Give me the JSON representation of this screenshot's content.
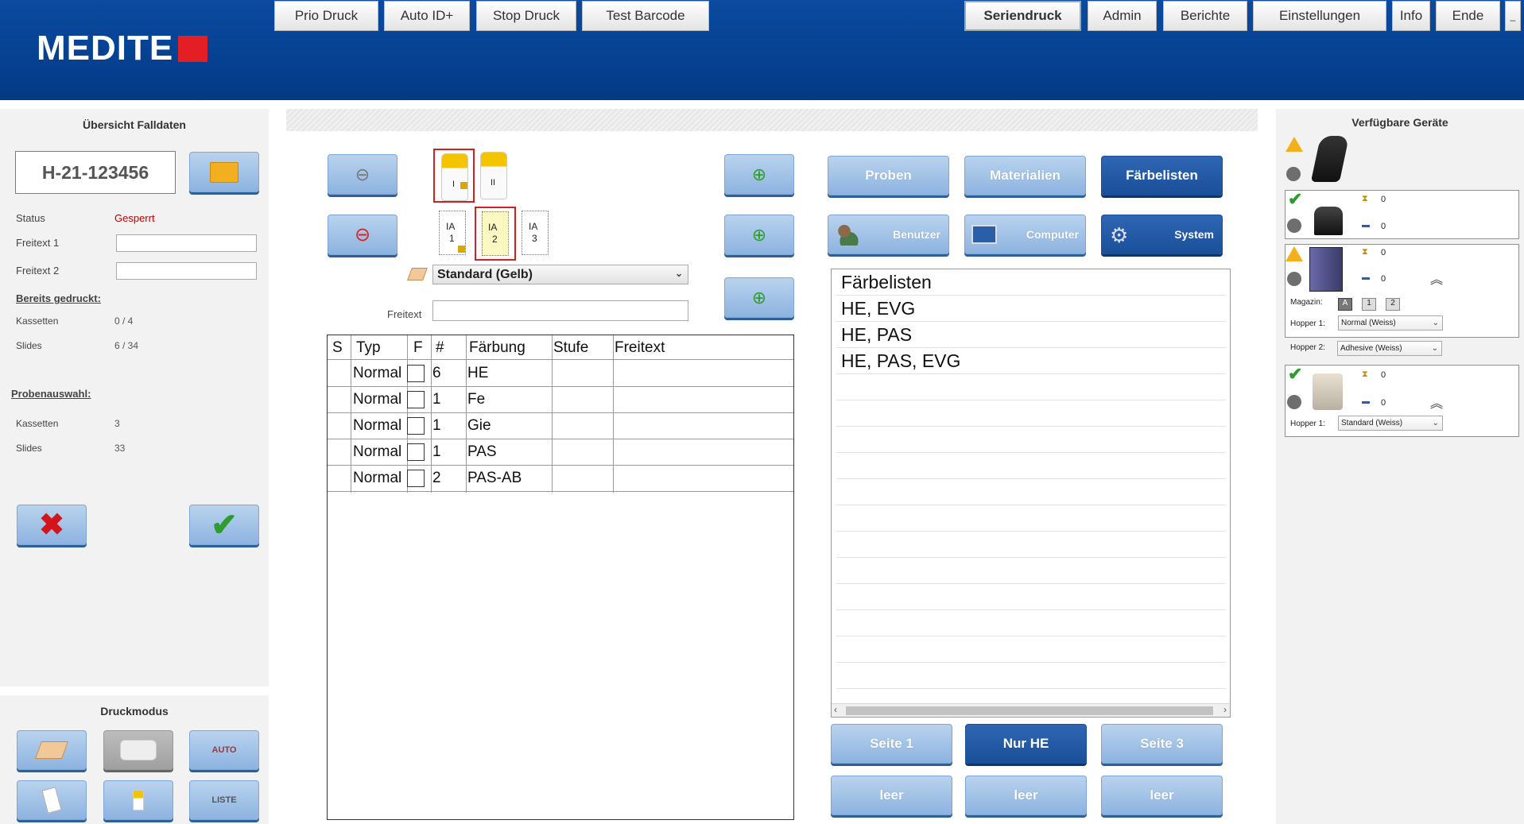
{
  "header": {
    "logo": "MEDITE",
    "left_buttons": [
      "Prio Druck",
      "Auto ID+",
      "Stop Druck",
      "Test Barcode"
    ],
    "right_buttons": [
      "Seriendruck",
      "Admin",
      "Berichte",
      "Einstellungen",
      "Info",
      "Ende",
      "_"
    ]
  },
  "left": {
    "title": "Übersicht Falldaten",
    "case_id": "H-21-123456",
    "status_label": "Status",
    "status_value": "Gesperrt",
    "freitext1_label": "Freitext 1",
    "freitext2_label": "Freitext 2",
    "bereits_label": "Bereits gedruckt:",
    "kassetten_label": "Kassetten",
    "kassetten_value": "0 / 4",
    "slides_label": "Slides",
    "slides_value": "6 / 34",
    "proben_label": "Probenauswahl:",
    "kassetten2_label": "Kassetten",
    "kassetten2_value": "3",
    "slides2_label": "Slides",
    "slides2_value": "33",
    "druckmodus_title": "Druckmodus",
    "auto_label": "AUTO",
    "liste_label": "LISTE"
  },
  "center": {
    "container_labels": [
      "I",
      "II"
    ],
    "slide_labels": [
      {
        "line1": "IA",
        "line2": "1"
      },
      {
        "line1": "IA",
        "line2": "2"
      },
      {
        "line1": "IA",
        "line2": "3"
      }
    ],
    "dropdown_value": "Standard (Gelb)",
    "freitext_label": "Freitext",
    "table": {
      "headers": [
        "S",
        "Typ",
        "F",
        "#",
        "Färbung",
        "Stufe",
        "Freitext"
      ],
      "rows": [
        {
          "typ": "Normal",
          "num": "6",
          "faerbung": "HE"
        },
        {
          "typ": "Normal",
          "num": "1",
          "faerbung": "Fe"
        },
        {
          "typ": "Normal",
          "num": "1",
          "faerbung": "Gie"
        },
        {
          "typ": "Normal",
          "num": "1",
          "faerbung": "PAS"
        },
        {
          "typ": "Normal",
          "num": "2",
          "faerbung": "PAS-AB"
        }
      ]
    }
  },
  "tabs": {
    "proben": "Proben",
    "materialien": "Materialien",
    "faerbelisten": "Färbelisten",
    "benutzer": "Benutzer",
    "computer": "Computer",
    "system": "System"
  },
  "faerbelisten_items": [
    "Färbelisten",
    "HE, EVG",
    "HE, PAS",
    "HE, PAS, EVG"
  ],
  "pages": {
    "seite1": "Seite 1",
    "nurhe": "Nur HE",
    "seite3": "Seite 3",
    "leer1": "leer",
    "leer2": "leer",
    "leer3": "leer"
  },
  "devices": {
    "title": "Verfügbare Geräte",
    "dev2": {
      "count1": "0",
      "count2": "0"
    },
    "dev3": {
      "count1": "0",
      "count2": "0",
      "magazin_label": "Magazin:",
      "mag_buttons": [
        "A",
        "1",
        "2"
      ],
      "hopper1_label": "Hopper 1:",
      "hopper1_value": "Normal (Weiss)",
      "hopper2_label": "Hopper 2:",
      "hopper2_value": "Adhesive (Weiss)"
    },
    "dev4": {
      "count1": "0",
      "count2": "0",
      "hopper1_label": "Hopper 1:",
      "hopper1_value": "Standard (Weiss)"
    }
  },
  "colors": {
    "header_blue": "#0a4aa0",
    "accent_red": "#e31e24",
    "status_red": "#c00000",
    "button_light_blue": "#8db3e0",
    "button_dark_blue": "#1a4f99"
  }
}
